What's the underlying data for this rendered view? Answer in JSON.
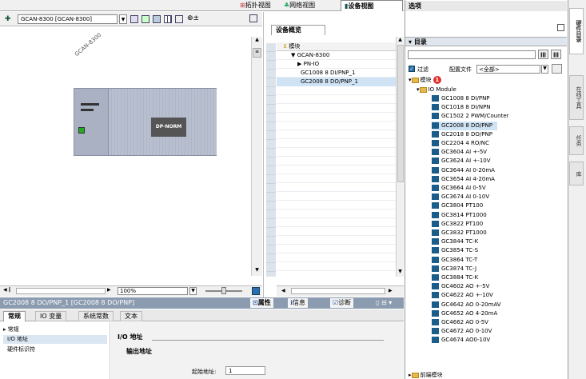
{
  "topbar": {
    "tab_topology": "拓扑视图",
    "tab_network": "网络视图",
    "tab_device": "设备视图"
  },
  "device_toolbar": {
    "device_select": "GCAN-8300 [GCAN-8300]"
  },
  "canvas": {
    "rack_label": "GCAN-8300",
    "module_label": "DP-NORM",
    "zoom": "100%"
  },
  "overview": {
    "title": "设备概览",
    "col_module": "模块",
    "rows": [
      "GCAN-8300",
      "PN-IO",
      "GC1008 8 DI/PNP_1",
      "GC2008 8 DO/PNP_1"
    ]
  },
  "selection": {
    "title": "GC2008 8 DO/PNP_1 [GC2008 8 DO/PNP]"
  },
  "inspector": {
    "tab_props": "属性",
    "tab_info": "信息",
    "tab_diag": "诊断",
    "tab_general": "常规",
    "tab_io": "IO 变量",
    "tab_const": "系统常数",
    "tab_text": "文本",
    "nav_general": "常规",
    "nav_io_addr": "I/O 地址",
    "nav_hw_id": "硬件标识符",
    "section_io": "I/O 地址",
    "section_out": "输出地址",
    "start_addr_label": "起始地址:",
    "start_addr_value": "1"
  },
  "catalog": {
    "header": "选项",
    "section": "目录",
    "filter": "过滤",
    "profile_label": "配置文件",
    "profile_value": "<全部>",
    "folder_module": "模块",
    "badge": "1",
    "folder_io": "IO Module",
    "items": [
      "GC1008 8 DI/PNP",
      "GC1018 8 DI/NPN",
      "GC1502 2 PWM/Counter",
      "GC2008 8 DO/PNP",
      "GC2018 8 DO/PNP",
      "GC2204 4 RO/NC",
      "GC3604 AI +-5V",
      "GC3624 AI +-10V",
      "GC3644 AI 0-20mA",
      "GC3654 AI 4-20mA",
      "GC3664 AI 0-5V",
      "GC3674 AI 0-10V",
      "GC3804 PT100",
      "GC3814 PT1000",
      "GC3822 PT100",
      "GC3832 PT1000",
      "GC3844 TC-K",
      "GC3854 TC-S",
      "GC3864 TC-T",
      "GC3874 TC-J",
      "GC3884 TC-K",
      "GC4602 AO +-5V",
      "GC4622 AO +-10V",
      "GC4642 AO 0-20mAV",
      "GC4652 AO 4-20mA",
      "GC4662 AO 0-5V",
      "GC4672 AO 0-10V",
      "GC4674 AO0-10V"
    ],
    "last_folder": "前端模块"
  },
  "sidetabs": [
    "硬件目录",
    "在线工具",
    "任务",
    "库"
  ]
}
